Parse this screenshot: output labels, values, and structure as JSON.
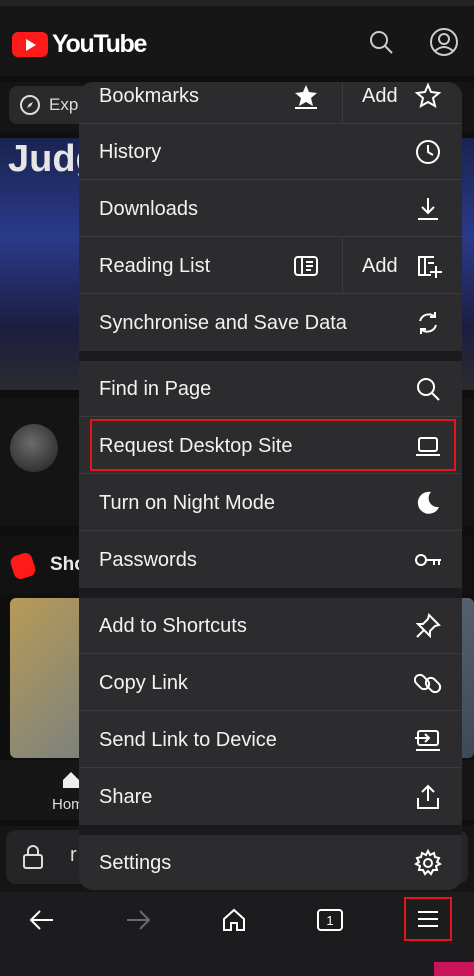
{
  "youtube": {
    "brand": "YouTube",
    "chip_label": "Exp",
    "video_title_fragment": "Judg",
    "shorts_label": "Sho",
    "tab_home_label": "Hom",
    "url_fragment": "r"
  },
  "menu": {
    "items": [
      {
        "label": "Bookmarks",
        "icon": "star-filled-icon",
        "secondary_label": "Add",
        "secondary_icon": "star-outline-icon"
      },
      {
        "label": "History",
        "icon": "clock-icon"
      },
      {
        "label": "Downloads",
        "icon": "download-icon"
      },
      {
        "label": "Reading List",
        "icon": "reading-list-icon",
        "secondary_label": "Add",
        "secondary_icon": "add-reading-list-icon"
      },
      {
        "label": "Synchronise and Save Data",
        "icon": "sync-icon"
      },
      {
        "label": "Find in Page",
        "icon": "search-icon"
      },
      {
        "label": "Request Desktop Site",
        "icon": "laptop-icon",
        "highlighted": true
      },
      {
        "label": "Turn on Night Mode",
        "icon": "moon-icon"
      },
      {
        "label": "Passwords",
        "icon": "key-icon"
      },
      {
        "label": "Add to Shortcuts",
        "icon": "pin-icon"
      },
      {
        "label": "Copy Link",
        "icon": "link-icon"
      },
      {
        "label": "Send Link to Device",
        "icon": "send-to-device-icon"
      },
      {
        "label": "Share",
        "icon": "share-icon"
      },
      {
        "label": "Settings",
        "icon": "gear-icon"
      }
    ]
  },
  "toolbar": {
    "tab_count": "1",
    "buttons": [
      "back-arrow-icon",
      "forward-arrow-icon",
      "home-icon",
      "tabs-icon",
      "menu-icon"
    ]
  },
  "colors": {
    "highlight": "#e3141c",
    "menu_bg": "#2c2c2e",
    "youtube_red": "#ff1a1a"
  }
}
